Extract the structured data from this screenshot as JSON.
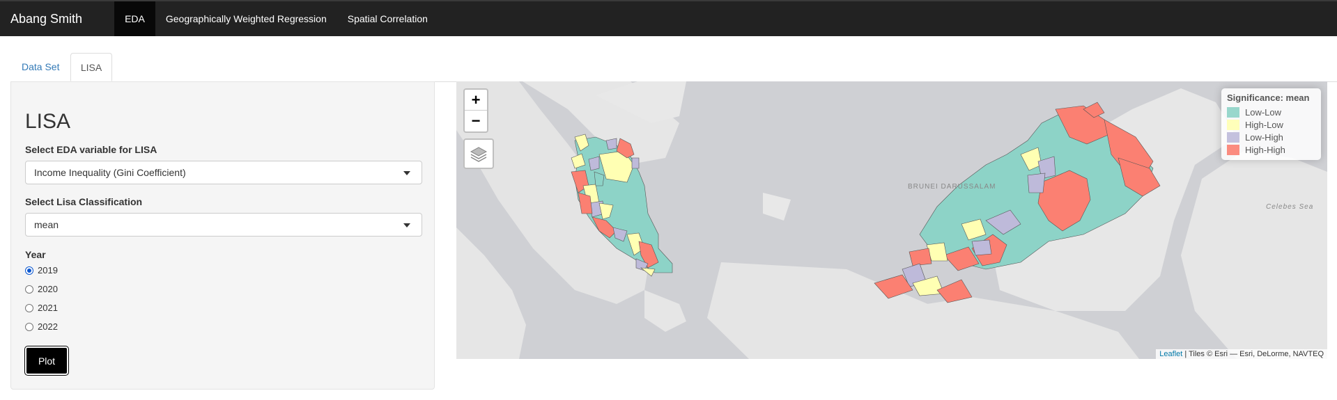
{
  "navbar": {
    "brand": "Abang Smith",
    "items": [
      "EDA",
      "Geographically Weighted Regression",
      "Spatial Correlation"
    ]
  },
  "tabs": [
    "Data Set",
    "LISA"
  ],
  "sidebar": {
    "title": "LISA",
    "variable_label": "Select EDA variable for LISA",
    "variable_value": "Income Inequality (Gini Coefficient)",
    "classification_label": "Select Lisa Classification",
    "classification_value": "mean",
    "year_label": "Year",
    "years": [
      "2019",
      "2020",
      "2021",
      "2022"
    ],
    "selected_year": "2019",
    "plot_button": "Plot"
  },
  "map": {
    "zoom_in": "+",
    "zoom_out": "−",
    "layers_icon": "layers-icon",
    "legend": {
      "title": "Significance: mean",
      "items": [
        {
          "label": "Low-Low",
          "color": "#8dd3c7"
        },
        {
          "label": "High-Low",
          "color": "#ffffb3"
        },
        {
          "label": "Low-High",
          "color": "#bebada"
        },
        {
          "label": "High-High",
          "color": "#fb8072"
        }
      ]
    },
    "places": [
      "BRUNEI DARUSSALAM",
      "Celebes Sea"
    ],
    "attribution": {
      "link": "Leaflet",
      "text": " | Tiles © Esri — Esri, DeLorme, NAVTEQ"
    }
  }
}
